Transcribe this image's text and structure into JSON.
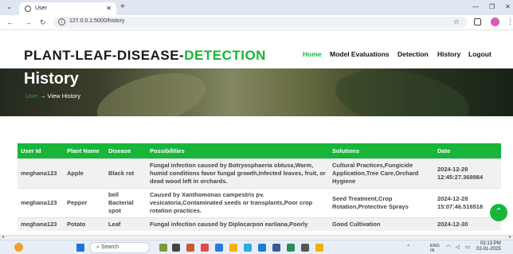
{
  "browser": {
    "tab_title": "User",
    "url": "127.0.0.1:5000/history"
  },
  "site": {
    "logo_main": "PLANT-LEAF-DISEASE-",
    "logo_accent": "DETECTION",
    "menu": [
      "Home",
      "Model Evaluations",
      "Detection",
      "History",
      "Logout"
    ],
    "active_menu": "Home"
  },
  "hero": {
    "title": "History",
    "crumb_user": "User",
    "crumb_arrow": "→",
    "crumb_current": "View History"
  },
  "table": {
    "headers": [
      "User Id",
      "Plant Name",
      "Disease",
      "Possibilities",
      "Solutions",
      "Date"
    ],
    "rows": [
      [
        "meghana123",
        "Apple",
        "Black rot",
        "Fungal infection caused by Botryosphaeria obtusa,Warm, humid conditions favor fungal growth,Infected leaves, fruit, or dead wood left in orchards.",
        "Cultural Practices,Fungicide Application,Tree Care,Orchard Hygiene",
        "2024-12-28 12:45:27.368984"
      ],
      [
        "meghana123",
        "Pepper",
        "bell Bacterial spot",
        "Caused by Xanthomonas campestris pv. vesicatoria,Contaminated seeds or transplants,Poor crop rotation practices.",
        "Seed Treatment,Crop Rotation,Protective Sprays",
        "2024-12-28 15:07:46.516518"
      ],
      [
        "meghana123",
        "Potato",
        "Leaf",
        "Fungal infection caused by Diplocarpon earliana,Poorly",
        "Good Cultivation",
        "2024-12-30"
      ]
    ]
  },
  "taskbar": {
    "search": "Search",
    "lang": "ENG",
    "region": "IN",
    "time": "02:13 PM",
    "date": "02-01-2025"
  },
  "colors": {
    "accent": "#18b53a",
    "browser_bar": "#dfe6f2"
  }
}
